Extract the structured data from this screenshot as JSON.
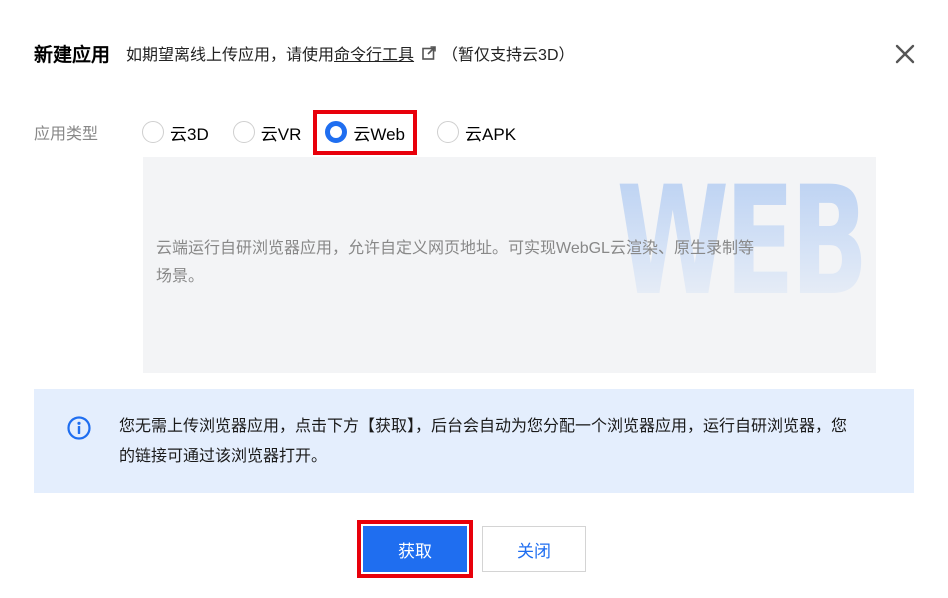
{
  "header": {
    "title": "新建应用",
    "subtitle_prefix": "如期望离线上传应用，请使用",
    "subtitle_link": "命令行工具",
    "subtitle_suffix": "（暂仅支持云3D）"
  },
  "icons": {
    "external_link": "external-link-icon",
    "close": "close-icon",
    "info": "info-icon"
  },
  "app_type": {
    "label": "应用类型",
    "options": [
      {
        "label": "云3D",
        "selected": false
      },
      {
        "label": "云VR",
        "selected": false
      },
      {
        "label": "云Web",
        "selected": true
      },
      {
        "label": "云APK",
        "selected": false
      }
    ]
  },
  "description": {
    "watermark": "WEB",
    "text": "云端运行自研浏览器应用，允许自定义网页地址。可实现WebGL云渲染、原生录制等场景。"
  },
  "info": {
    "text": "您无需上传浏览器应用，点击下方【获取】，后台会自动为您分配一个浏览器应用，运行自研浏览器，您的链接可通过该浏览器打开。"
  },
  "footer": {
    "primary_label": "获取",
    "secondary_label": "关闭"
  },
  "colors": {
    "accent": "#1f6ef0",
    "highlight": "#e8000b",
    "info_bg": "#e4eefd"
  }
}
